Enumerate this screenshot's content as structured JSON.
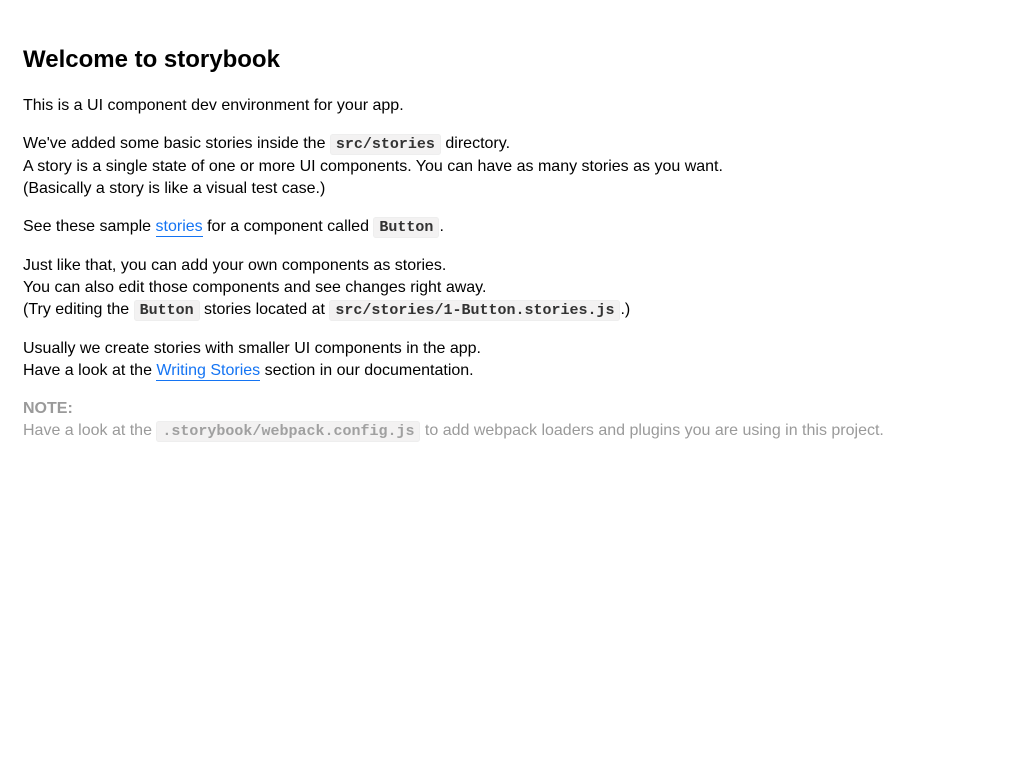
{
  "title": "Welcome to storybook",
  "intro": "This is a UI component dev environment for your app.",
  "added": {
    "before": "We've added some basic stories inside the ",
    "code": "src/stories",
    "after": " directory.",
    "line2": "A story is a single state of one or more UI components. You can have as many stories as you want.",
    "line3": "(Basically a story is like a visual test case.)"
  },
  "sample": {
    "before": "See these sample ",
    "link": "stories",
    "middle": " for a component called ",
    "code": "Button",
    "after": "."
  },
  "own": {
    "line1": "Just like that, you can add your own components as stories.",
    "line2": "You can also edit those components and see changes right away.",
    "line3_before": "(Try editing the ",
    "line3_code1": "Button",
    "line3_middle": " stories located at ",
    "line3_code2": "src/stories/1-Button.stories.js",
    "line3_after": ".)"
  },
  "usually": {
    "line1": "Usually we create stories with smaller UI components in the app.",
    "line2_before": "Have a look at the ",
    "line2_link": "Writing Stories",
    "line2_after": " section in our documentation."
  },
  "note": {
    "label": "NOTE:",
    "before": "Have a look at the ",
    "code": ".storybook/webpack.config.js",
    "after": " to add webpack loaders and plugins you are using in this project."
  },
  "colors": {
    "link": "#1474f3",
    "note_text": "#9a9a9a",
    "code_bg": "#f3f2f2"
  }
}
